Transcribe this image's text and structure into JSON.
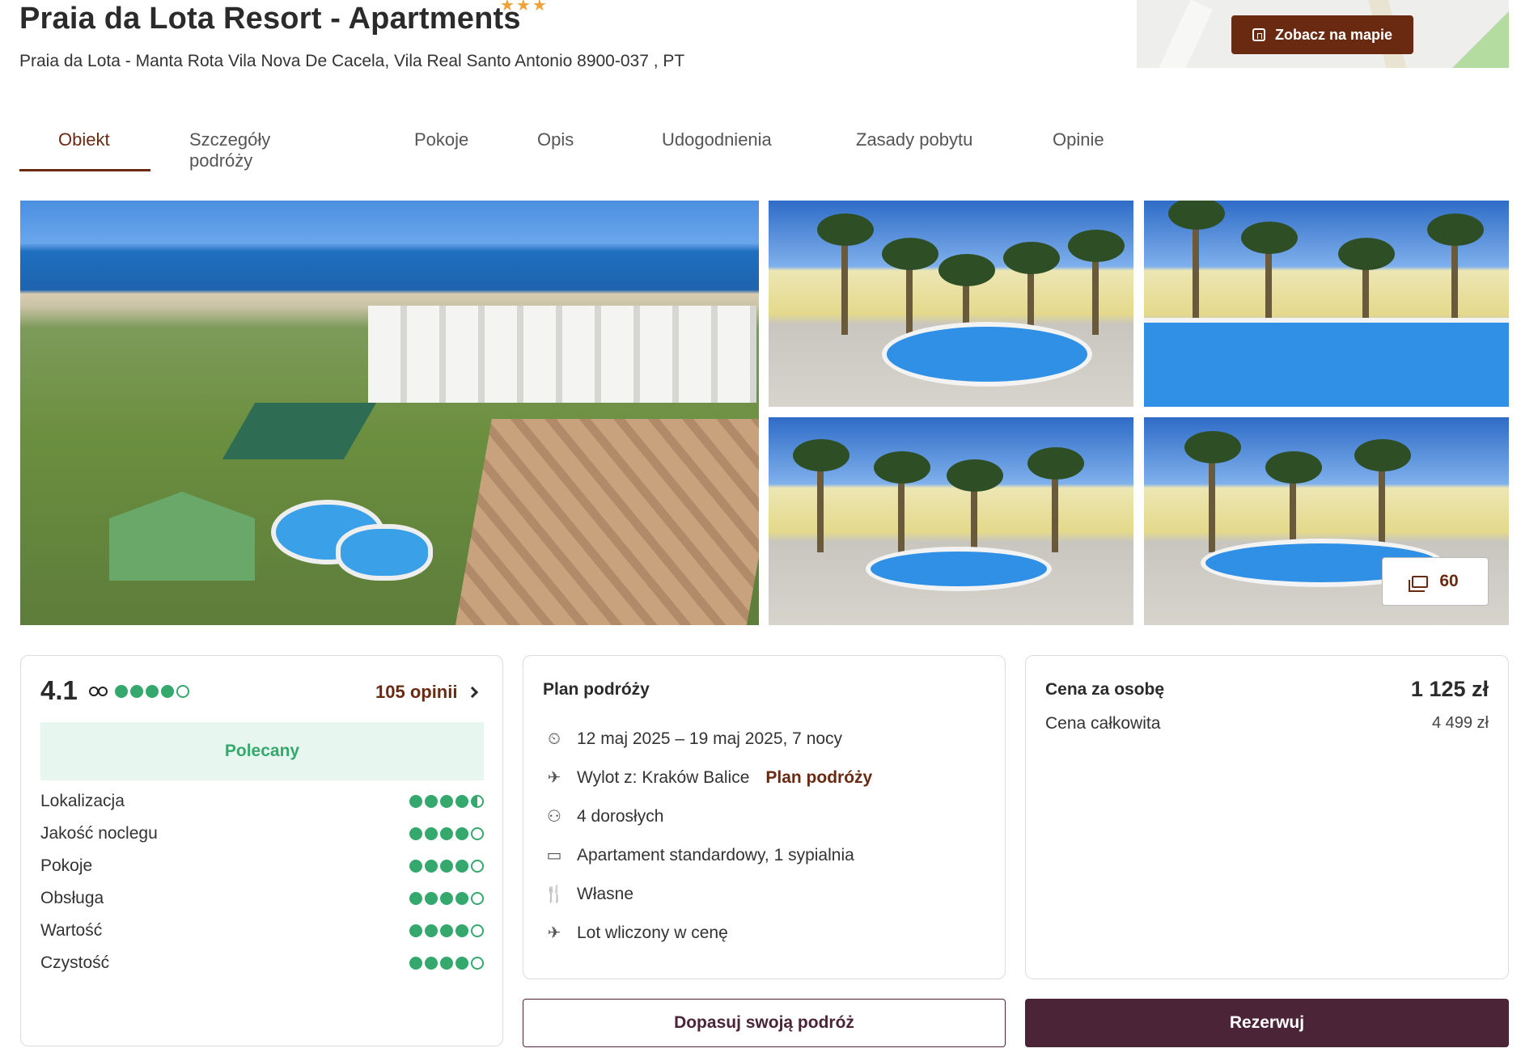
{
  "header": {
    "title": "Praia da Lota Resort - Apartments",
    "stars": "★★★",
    "address": "Praia da Lota - Manta Rota Vila Nova De Cacela, Vila Real Santo Antonio 8900-037 , PT",
    "map_button_label": "Zobacz na mapie"
  },
  "tabs": [
    {
      "label": "Obiekt",
      "active": true
    },
    {
      "label": "Szczegóły podróży"
    },
    {
      "label": "Pokoje"
    },
    {
      "label": "Opis"
    },
    {
      "label": "Udogodnienia"
    },
    {
      "label": "Zasady pobytu"
    },
    {
      "label": "Opinie"
    }
  ],
  "gallery": {
    "photo_count": "60"
  },
  "reviews": {
    "score": "4.1",
    "score_dots": 4,
    "reviews_link": "105 opinii",
    "recommended_label": "Polecany",
    "categories": [
      {
        "label": "Lokalizacja",
        "rating": 4.5
      },
      {
        "label": "Jakość noclegu",
        "rating": 4
      },
      {
        "label": "Pokoje",
        "rating": 4
      },
      {
        "label": "Obsługa",
        "rating": 4
      },
      {
        "label": "Wartość",
        "rating": 4
      },
      {
        "label": "Czystość",
        "rating": 4
      }
    ]
  },
  "plan": {
    "title": "Plan podróży",
    "dates": "12 maj 2025 – 19 maj 2025, 7 nocy",
    "departure": "Wylot z: Kraków Balice",
    "departure_link": "Plan podróży",
    "guests": "4 dorosłych",
    "room": "Apartament standardowy, 1 sypialnia",
    "board": "Własne",
    "flight": "Lot wliczony w cenę"
  },
  "price": {
    "per_person_label": "Cena za osobę",
    "per_person_value": "1 125 zł",
    "total_label": "Cena całkowita",
    "total_value": "4 499 zł"
  },
  "actions": {
    "adjust_label": "Dopasuj swoją podróż",
    "book_label": "Rezerwuj"
  },
  "colors": {
    "accent": "#6a2a12",
    "primary_button": "#4b2438",
    "rating_green": "#34a86d",
    "recommended_bg": "#e7f6ee"
  }
}
